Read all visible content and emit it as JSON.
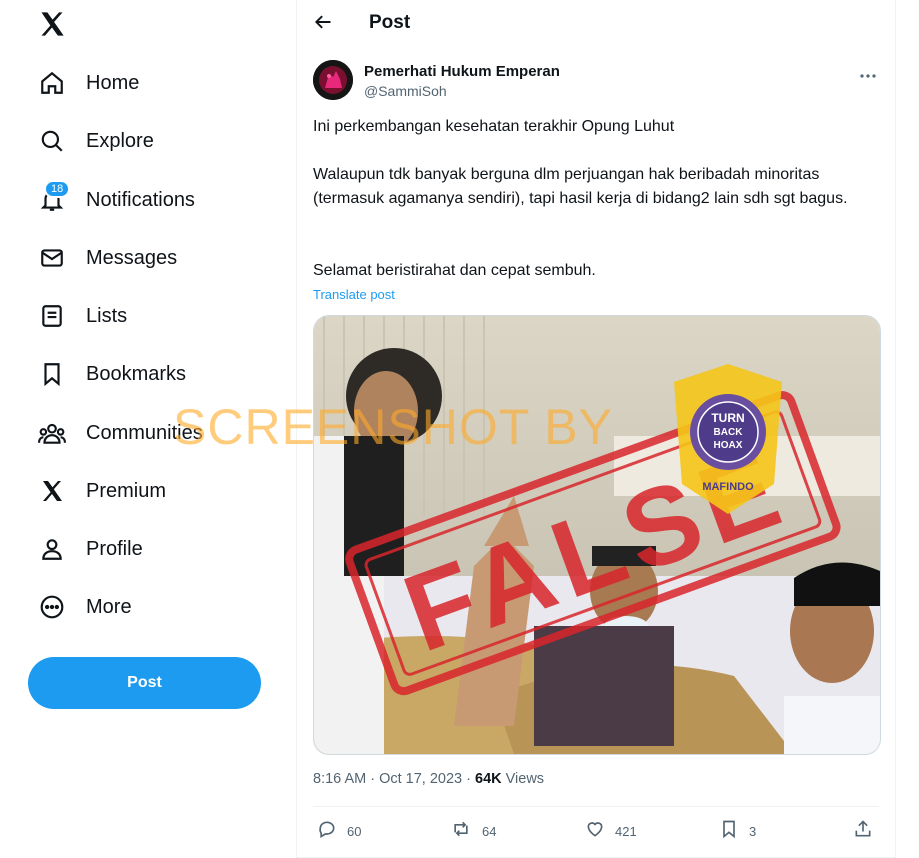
{
  "nav": {
    "items": [
      {
        "label": "Home",
        "icon": "home-icon"
      },
      {
        "label": "Explore",
        "icon": "search-icon"
      },
      {
        "label": "Notifications",
        "icon": "bell-icon",
        "badge": "18"
      },
      {
        "label": "Messages",
        "icon": "envelope-icon"
      },
      {
        "label": "Lists",
        "icon": "list-icon"
      },
      {
        "label": "Bookmarks",
        "icon": "bookmark-icon"
      },
      {
        "label": "Communities",
        "icon": "people-icon"
      },
      {
        "label": "Premium",
        "icon": "x-logo-icon"
      },
      {
        "label": "Profile",
        "icon": "person-icon"
      },
      {
        "label": "More",
        "icon": "more-circle-icon"
      }
    ],
    "post_button": "Post"
  },
  "header": {
    "title": "Post"
  },
  "tweet": {
    "author_name": "Pemerhati Hukum Emperan",
    "author_handle": "@SammiSoh",
    "text_lines": [
      "Ini perkembangan kesehatan terakhir Opung Luhut",
      "Walaupun tdk banyak berguna dlm perjuangan hak beribadah minoritas (termasuk agamanya sendiri), tapi hasil kerja di bidang2 lain sdh sgt bagus.",
      "Selamat beristirahat dan cepat sembuh."
    ],
    "translate": "Translate post",
    "time": "8:16 AM · Oct 17, 2023 · ",
    "views_count": "64K",
    "views_label": " Views",
    "actions": {
      "replies": "60",
      "reposts": "64",
      "likes": "421",
      "bookmarks": "3"
    }
  },
  "overlay": {
    "watermark": "SCREENSHOT BY",
    "stamp": "FALSE",
    "logo_top": "MASYARAKAT ANTI FITNAH INDONESIA",
    "logo_lines": [
      "TURN",
      "BACK",
      "HOAX"
    ],
    "logo_bottom": "MAFINDO"
  },
  "colors": {
    "accent": "#1d9bf0",
    "stamp": "#d8262c",
    "watermark": "#ffaa28"
  }
}
